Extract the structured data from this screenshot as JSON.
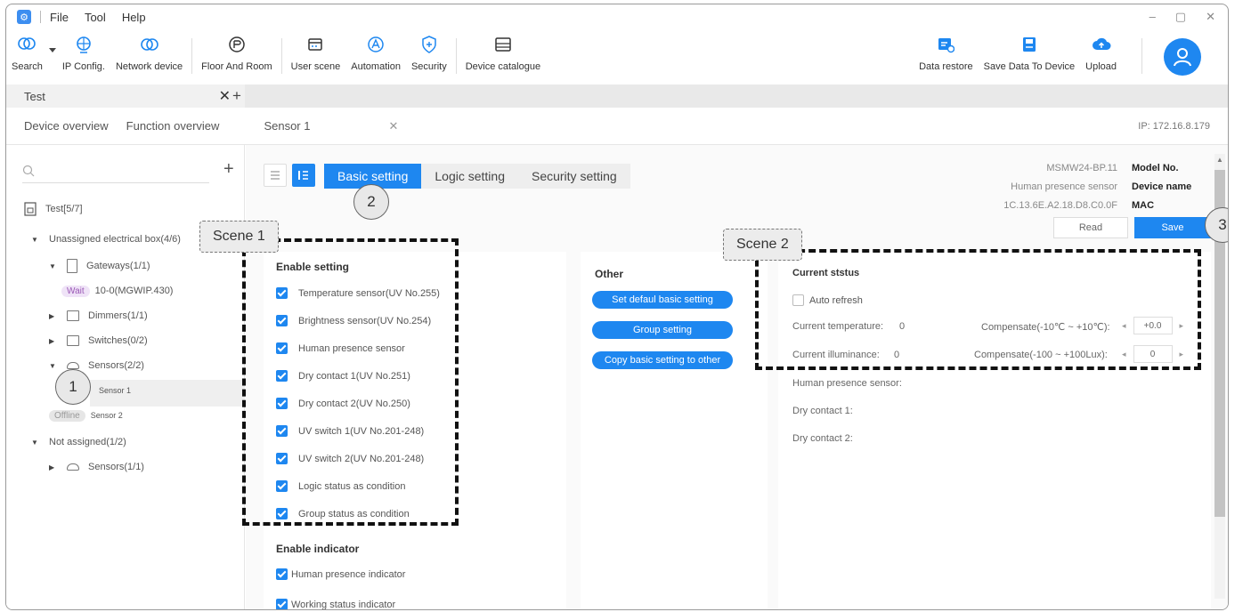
{
  "titlebar": {
    "menu": [
      "File",
      "Tool",
      "Help"
    ],
    "controls": [
      "–",
      "▢",
      "✕"
    ]
  },
  "toolbar": {
    "search": "Search",
    "ip_config": "IP Config.",
    "network_device": "Network device",
    "floor_and_room": "Floor And Room",
    "user_scene": "User scene",
    "automation": "Automation",
    "security": "Security",
    "device_catalogue": "Device catalogue",
    "data_restore": "Data restore",
    "save_data": "Save Data To Device",
    "upload": "Upload"
  },
  "tabs": {
    "active": "Test",
    "close": "✕",
    "add": "+"
  },
  "subnav": {
    "device_overview": "Device overview",
    "function_overview": "Function overview",
    "sensor_tab": "Sensor 1",
    "close": "✕",
    "ip": "IP: 172.16.8.179"
  },
  "sidebar": {
    "add": "+",
    "tree": {
      "root": "Test[5/7]",
      "unassigned_box": "Unassigned electrical box(4/6)",
      "gateways": "Gateways(1/1)",
      "gateway_status": "Wait",
      "gateway_item": "10-0(MGWIP.430)",
      "dimmers": "Dimmers(1/1)",
      "switches": "Switches(0/2)",
      "sensors": "Sensors(2/2)",
      "sensor1": "Sensor 1",
      "sensor2_status": "Offline",
      "sensor2": "Sensor 2",
      "not_assigned": "Not assigned(1/2)",
      "sensors_na": "Sensors(1/1)"
    }
  },
  "content": {
    "tabs": [
      "Basic setting",
      "Logic setting",
      "Security setting"
    ],
    "device_info": {
      "model_value": "MSMW24-BP.11",
      "model_label": "Model No.",
      "name_value": "Human presence sensor",
      "name_label": "Device name",
      "mac_value": "1C.13.6E.A2.18.D8.C0.0F",
      "mac_label": "MAC"
    },
    "read_label": "Read",
    "save_label": "Save",
    "enable_setting": {
      "title": "Enable setting",
      "items": [
        "Temperature sensor(UV No.255)",
        "Brightness sensor(UV No.254)",
        "Human presence sensor",
        "Dry contact 1(UV No.251)",
        "Dry contact 2(UV No.250)",
        "UV switch 1(UV No.201-248)",
        "UV switch 2(UV No.201-248)",
        "Logic status as condition",
        "Group status as condition"
      ]
    },
    "enable_indicator": {
      "title": "Enable indicator",
      "items": [
        "Human presence indicator",
        "Working status indicator"
      ]
    },
    "other": {
      "title": "Other",
      "buttons": [
        "Set defaul basic setting",
        "Group setting",
        "Copy basic setting to other"
      ]
    },
    "status": {
      "title": "Current ststus",
      "auto_refresh": "Auto refresh",
      "temp_label": "Current temperature:",
      "temp_value": "0",
      "temp_comp_label": "Compensate(-10℃ ~ +10℃):",
      "temp_comp_value": "+0.0",
      "lux_label": "Current illuminance:",
      "lux_value": "0",
      "lux_comp_label": "Compensate(-100 ~ +100Lux):",
      "lux_comp_value": "0",
      "presence_label": "Human presence sensor:",
      "dry1_label": "Dry contact 1:",
      "dry2_label": "Dry contact 2:",
      "dec": "◂",
      "inc": "▸"
    }
  },
  "annotations": {
    "scene1": "Scene 1",
    "scene2": "Scene 2",
    "num1": "1",
    "num2": "2",
    "num3": "3"
  },
  "colors": {
    "accent": "#1e87f0",
    "wait_badge_bg": "#efe3f7",
    "wait_badge_fg": "#9b59b6",
    "offline_badge_bg": "#e6e6e6"
  }
}
